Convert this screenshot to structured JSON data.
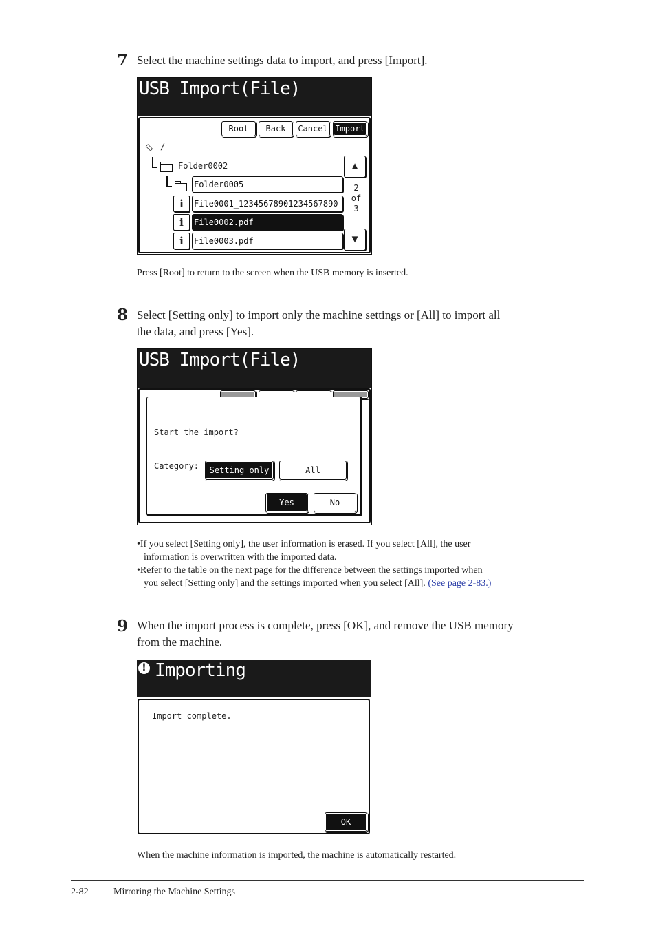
{
  "steps": [
    {
      "number": "7",
      "text": "Select the machine settings data to import, and press [Import].",
      "note": "Press [Root] to return to the screen when the USB memory is inserted."
    },
    {
      "number": "8",
      "text_line1": "Select [Setting only] to import only the machine settings or [All] to import all",
      "text_line2": "the data, and press [Yes].",
      "bullets": [
        {
          "line1": "If you select [Setting only], the user information is erased. If you select [All], the user",
          "line2": "information is overwritten with the imported data."
        },
        {
          "line1": "Refer to the table on the next page for the difference between the settings imported when",
          "line2": "you select [Setting only] and the settings imported when you select [All].",
          "link": "(See page 2-83.)"
        }
      ]
    },
    {
      "number": "9",
      "text_line1": "When the import process is complete, press [OK], and remove the USB memory",
      "text_line2": "from the machine.",
      "note": "When the machine information is imported, the machine is automatically restarted."
    }
  ],
  "screen1": {
    "title": "USB Import(File)",
    "buttons": {
      "root": "Root",
      "back": "Back",
      "cancel": "Cancel",
      "import": "Import"
    },
    "path_root": "/",
    "folders": [
      "Folder0002",
      "Folder0005"
    ],
    "files": [
      {
        "name": "File0001_12345678901234567890",
        "selected": false
      },
      {
        "name": "File0002.pdf",
        "selected": true
      },
      {
        "name": "File0003.pdf",
        "selected": false
      }
    ],
    "pager": {
      "current": "2",
      "of": "of",
      "total": "3"
    },
    "icons": {
      "up": "▲",
      "down": "▼",
      "info": "i"
    }
  },
  "screen2": {
    "title": "USB Import(File)",
    "dialog": {
      "question": "Start the import?",
      "category_label": "Category:",
      "options": [
        "Setting only",
        "All"
      ],
      "selected_option": "Setting only",
      "yes": "Yes",
      "no": "No"
    }
  },
  "screen3": {
    "title": "Importing",
    "message": "Import complete.",
    "ok": "OK"
  },
  "footer": {
    "page_number": "2-82",
    "section": "Mirroring the Machine Settings"
  },
  "colors": {
    "screen_bg": "#1a1a1a",
    "link": "#2b3ea8",
    "text": "#222222"
  }
}
